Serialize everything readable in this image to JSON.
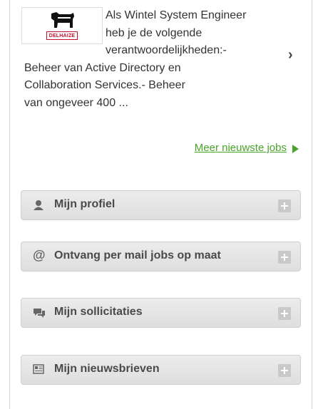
{
  "job": {
    "company_logo_text": "DELHAIZE",
    "description": "Als Wintel System Engineer heb je de volgende verantwoordelijkheden:- Beheer van Active Directory en Collaboration Services.- Beheer van ongeveer 400 ...",
    "line1": "Als Wintel System Engineer",
    "line2": "heb je de volgende",
    "line3": "verantwoordelijkheden:-",
    "line4": "Beheer van Active Directory en",
    "line5": "Collaboration Services.- Beheer",
    "line6": "van ongeveer 400 ...",
    "chevron": "›"
  },
  "more_jobs_link": "Meer nieuwste jobs",
  "panels": [
    {
      "label": "Mijn profiel",
      "icon": "user-icon"
    },
    {
      "label": "Ontvang per mail jobs op maat",
      "icon": "at-icon"
    },
    {
      "label": "Mijn sollicitaties",
      "icon": "chat-icon"
    },
    {
      "label": "Mijn nieuwsbrieven",
      "icon": "newspaper-icon"
    }
  ],
  "colors": {
    "link_green": "#4aa32a",
    "panel_bg": "#e4e4e4",
    "brand_red": "#c8102e"
  }
}
